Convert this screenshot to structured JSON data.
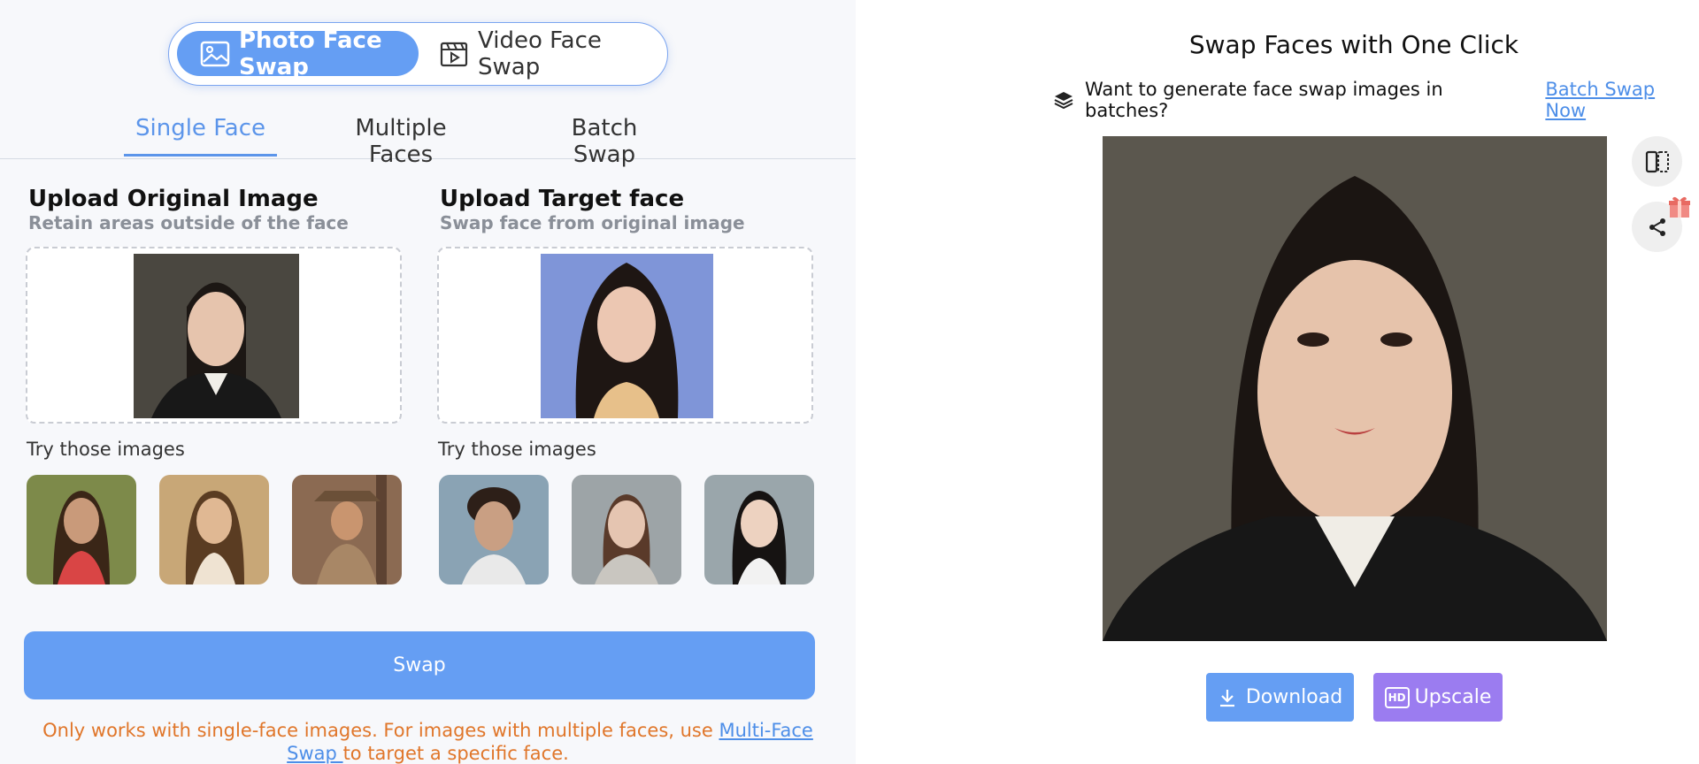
{
  "mode_switch": {
    "photo_label": "Photo Face Swap",
    "video_label": "Video Face Swap",
    "photo_icon": "image-icon",
    "video_icon": "video-clip-icon"
  },
  "tabs": [
    {
      "label": "Single Face",
      "active": true
    },
    {
      "label": "Multiple Faces",
      "active": false
    },
    {
      "label": "Batch Swap",
      "active": false
    }
  ],
  "original": {
    "title": "Upload Original Image",
    "subtitle": "Retain areas outside of the face",
    "try_label": "Try those images"
  },
  "target": {
    "title": "Upload Target face",
    "subtitle": "Swap face from original image",
    "try_label": "Try those images"
  },
  "swap_button": "Swap",
  "notice": {
    "before": "Only works with single-face images. For images with multiple faces, use ",
    "link": "Multi-Face Swap ",
    "after": "to target a specific face."
  },
  "right": {
    "title": "Swap Faces with One Click",
    "batch_text": "Want to generate face swap images in batches?",
    "batch_link": "Batch Swap Now",
    "download_label": "Download",
    "upscale_label": "Upscale",
    "upscale_badge": "HD"
  },
  "colors": {
    "accent": "#659ef3",
    "upscale": "#9b7cf0",
    "notice": "#e0762a",
    "link": "#4d8ee8"
  }
}
